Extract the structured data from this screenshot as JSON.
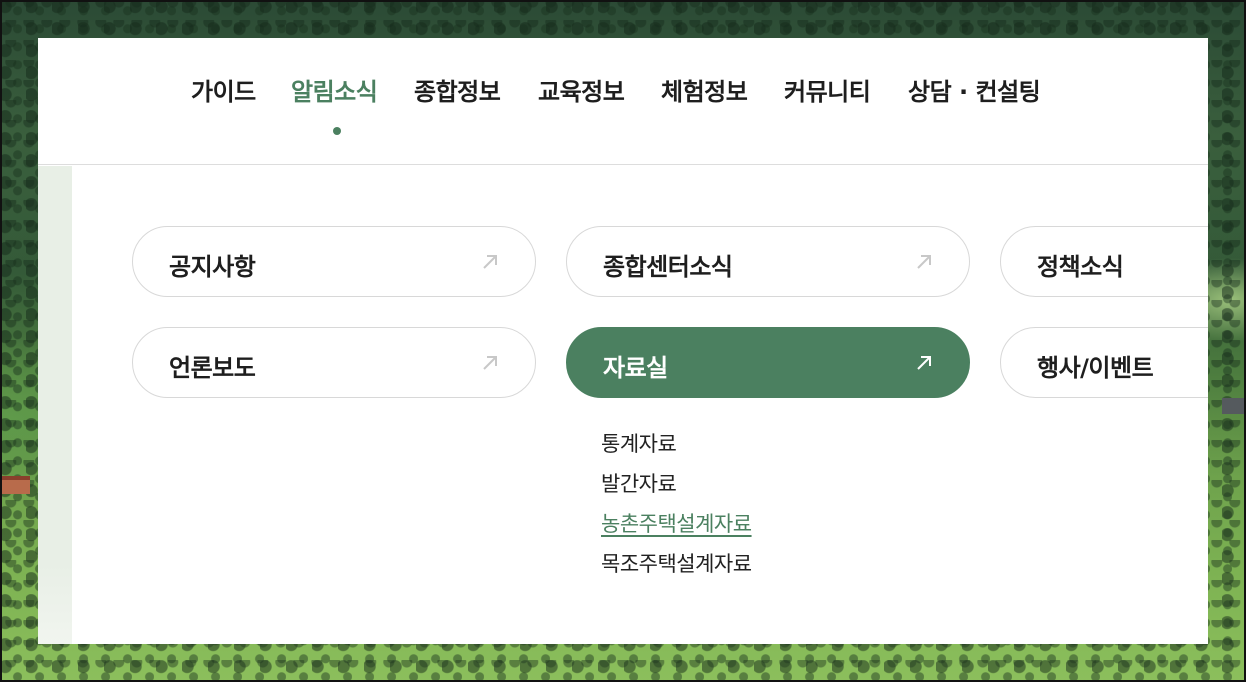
{
  "gnb": {
    "items": [
      {
        "label": "가이드"
      },
      {
        "label": "알림소식",
        "active": true
      },
      {
        "label": "종합정보"
      },
      {
        "label": "교육정보"
      },
      {
        "label": "체험정보"
      },
      {
        "label": "커뮤니티"
      },
      {
        "label": "상담 · 컨설팅"
      }
    ]
  },
  "submenu": {
    "items": [
      {
        "label": "공지사항"
      },
      {
        "label": "종합센터소식"
      },
      {
        "label": "정책소식"
      },
      {
        "label": "언론보도"
      },
      {
        "label": "자료실",
        "active": true
      },
      {
        "label": "행사/이벤트"
      }
    ],
    "children": [
      {
        "label": "통계자료"
      },
      {
        "label": "발간자료"
      },
      {
        "label": "농촌주택설계자료",
        "active": true
      },
      {
        "label": "목조주택설계자료"
      }
    ]
  },
  "icons": {
    "arrow": "arrow-up-right-icon"
  },
  "colors": {
    "accent": "#4b8060",
    "text": "#1e1e1e",
    "border": "#d8d8d8"
  }
}
